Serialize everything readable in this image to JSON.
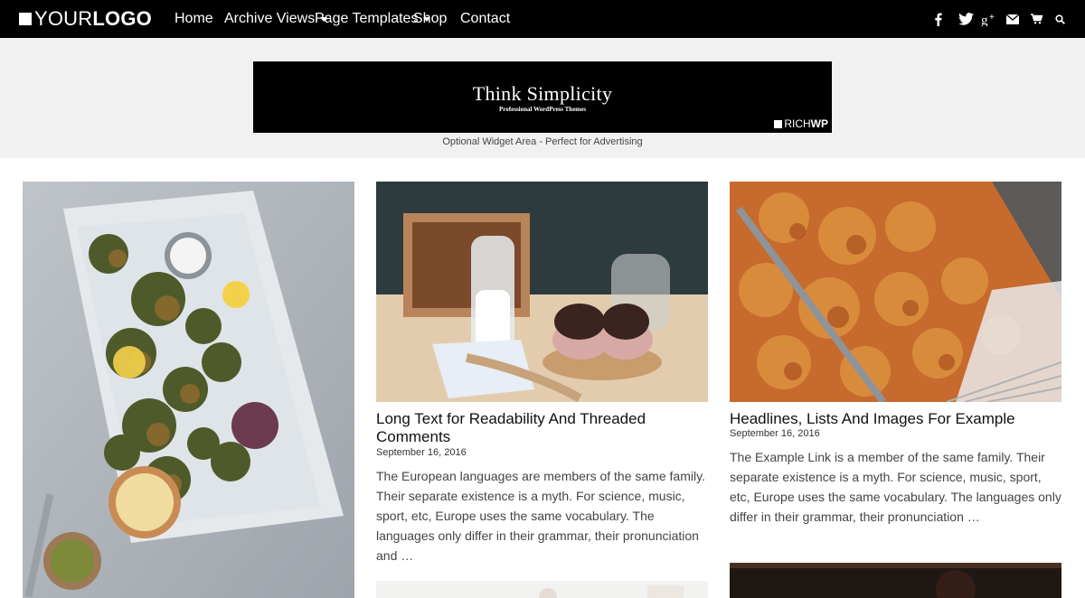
{
  "header": {
    "logo_light": "YOUR",
    "logo_bold": "LOGO",
    "nav": [
      {
        "label": "Home"
      },
      {
        "label": "Archive Views",
        "dropdown": true
      },
      {
        "label": "Page Templates",
        "dropdown": true
      },
      {
        "label": "Shop"
      },
      {
        "label": "Contact"
      }
    ],
    "icons": [
      "facebook-icon",
      "twitter-icon",
      "google-plus-icon",
      "mail-icon",
      "cart-icon",
      "search-icon"
    ]
  },
  "banner": {
    "title": "Think Simplicity",
    "subtitle": "Professional WordPress Themes",
    "brand_light": "RICH",
    "brand_bold": "WP",
    "caption": "Optional Widget Area - Perfect for Advertising"
  },
  "posts": [
    {
      "title": "Long Text for Readability And Threaded Comments",
      "date": "September 16, 2016",
      "excerpt": "The European languages are members of the same family. Their separate existence is a myth. For science, music, sport, etc, Europe uses the same vocabulary. The languages only differ in their grammar, their pronunciation and …"
    },
    {
      "title": "Headlines, Lists And Images For Example",
      "date": "September 16, 2016",
      "excerpt": "The Example Link is a member of the same family. Their separate existence is a myth. For science, music, sport, etc, Europe uses the same vocabulary. The languages only differ in their grammar, their pronunciation …"
    }
  ],
  "colors": {
    "topbar": "#000000",
    "banner_bg": "#f1f1f1",
    "text": "#444444"
  }
}
